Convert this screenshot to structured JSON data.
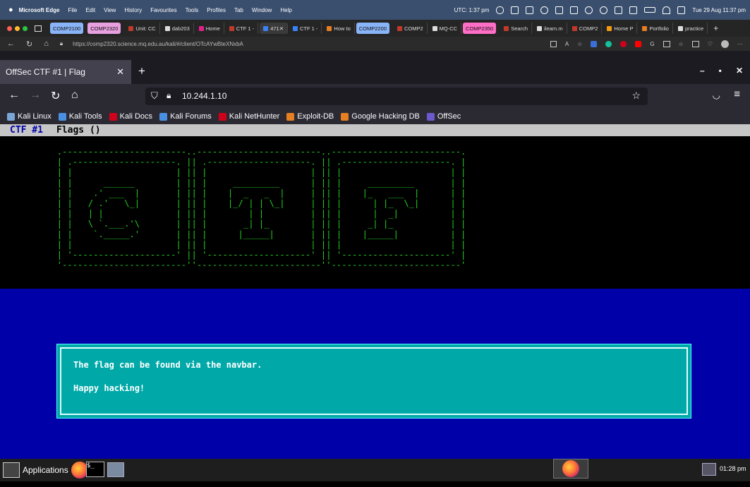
{
  "mac_menubar": {
    "app_name": "Microsoft Edge",
    "menus": [
      "File",
      "Edit",
      "View",
      "History",
      "Favourites",
      "Tools",
      "Profiles",
      "Tab",
      "Window",
      "Help"
    ],
    "utc_time": "UTC: 1:37 pm",
    "datetime": "Tue 29 Aug  11:37 pm"
  },
  "edge": {
    "tabs": [
      {
        "label": "COMP2100",
        "pill_color": "#8ab4f8"
      },
      {
        "label": "COMP2320",
        "pill_color": "#e8a0e0"
      },
      {
        "label": "Unit: CC",
        "icon_color": "#c0392b"
      },
      {
        "label": "dab203",
        "icon_color": "#dddddd"
      },
      {
        "label": "Home",
        "icon_color": "#e0218a"
      },
      {
        "label": "CTF 1 -",
        "icon_color": "#c0392b"
      },
      {
        "label": "471",
        "icon_color": "#3b82f6",
        "active": true
      },
      {
        "label": "CTF 1 -",
        "icon_color": "#3b82f6"
      },
      {
        "label": "How to",
        "icon_color": "#e67e22"
      },
      {
        "label": "COMP2200",
        "pill_color": "#8ab4f8"
      },
      {
        "label": "COMP2",
        "icon_color": "#c0392b"
      },
      {
        "label": "MQ-CC",
        "icon_color": "#dddddd"
      },
      {
        "label": "COMP2350",
        "pill_color": "#ff6ec7"
      },
      {
        "label": "Search",
        "icon_color": "#c0392b"
      },
      {
        "label": "ilearn.m",
        "icon_color": "#dddddd"
      },
      {
        "label": "COMP2",
        "icon_color": "#c0392b"
      },
      {
        "label": "Home P",
        "icon_color": "#f39c12"
      },
      {
        "label": "Portfolio",
        "icon_color": "#e67e22"
      },
      {
        "label": "practice",
        "icon_color": "#dddddd"
      }
    ],
    "url": "https://comp2320.science.mq.edu.au/kali/#/client/OTcAYwBteXNxbA"
  },
  "firefox": {
    "tab_title": "OffSec CTF #1 | Flag",
    "url": "10.244.1.10",
    "bookmarks": [
      {
        "label": "Kali Linux",
        "color": "#7aa6d6"
      },
      {
        "label": "Kali Tools",
        "color": "#4a90e2"
      },
      {
        "label": "Kali Docs",
        "color": "#d0021b"
      },
      {
        "label": "Kali Forums",
        "color": "#4a90e2"
      },
      {
        "label": "Kali NetHunter",
        "color": "#d0021b"
      },
      {
        "label": "Exploit-DB",
        "color": "#e67e22"
      },
      {
        "label": "Google Hacking DB",
        "color": "#e67e22"
      },
      {
        "label": "OffSec",
        "color": "#6a5acd"
      }
    ]
  },
  "ctf_page": {
    "menu_title": "CTF #1",
    "menu_item": "Flags ()",
    "ascii_color": "#22cc22",
    "ascii_art": "           .------------------------..------------------------..-------------------------.\n           | .--------------------. || .--------------------. || .---------------------. |\n           | |                    | || |                    | || |                     | |\n           | |      ______        | || |     _________      | || |     _________       | |\n           | |    .' ___  |       | || |    |  _   _  |     | || |    |_   ___  |      | |\n           | |   / .'   \\_|       | || |    |_/ | | \\_|     | || |      | |_  \\_|      | |\n           | |   | |              | || |        | |         | || |      |  _|          | |\n           | |   \\ `.___.'\\       | || |       _| |_        | || |     _| |_           | |\n           | |    `._____.'       | || |      |_____|       | || |    |_____|          | |\n           | |                    | || |                    | || |                     | |\n           | '--------------------' || '--------------------' || '---------------------' |\n           '------------------------''------------------------''-------------------------'",
    "message_line1": "The flag can be found via the navbar.",
    "message_line2": "Happy hacking!"
  },
  "taskbar": {
    "applications_label": "Applications",
    "clock": "01:28 pm"
  },
  "colors": {
    "mac_bar": "#3a4f6e",
    "ctf_blue": "#0000a8",
    "dialog_teal": "#00a8a8",
    "menu_gray": "#c6c6c6"
  }
}
